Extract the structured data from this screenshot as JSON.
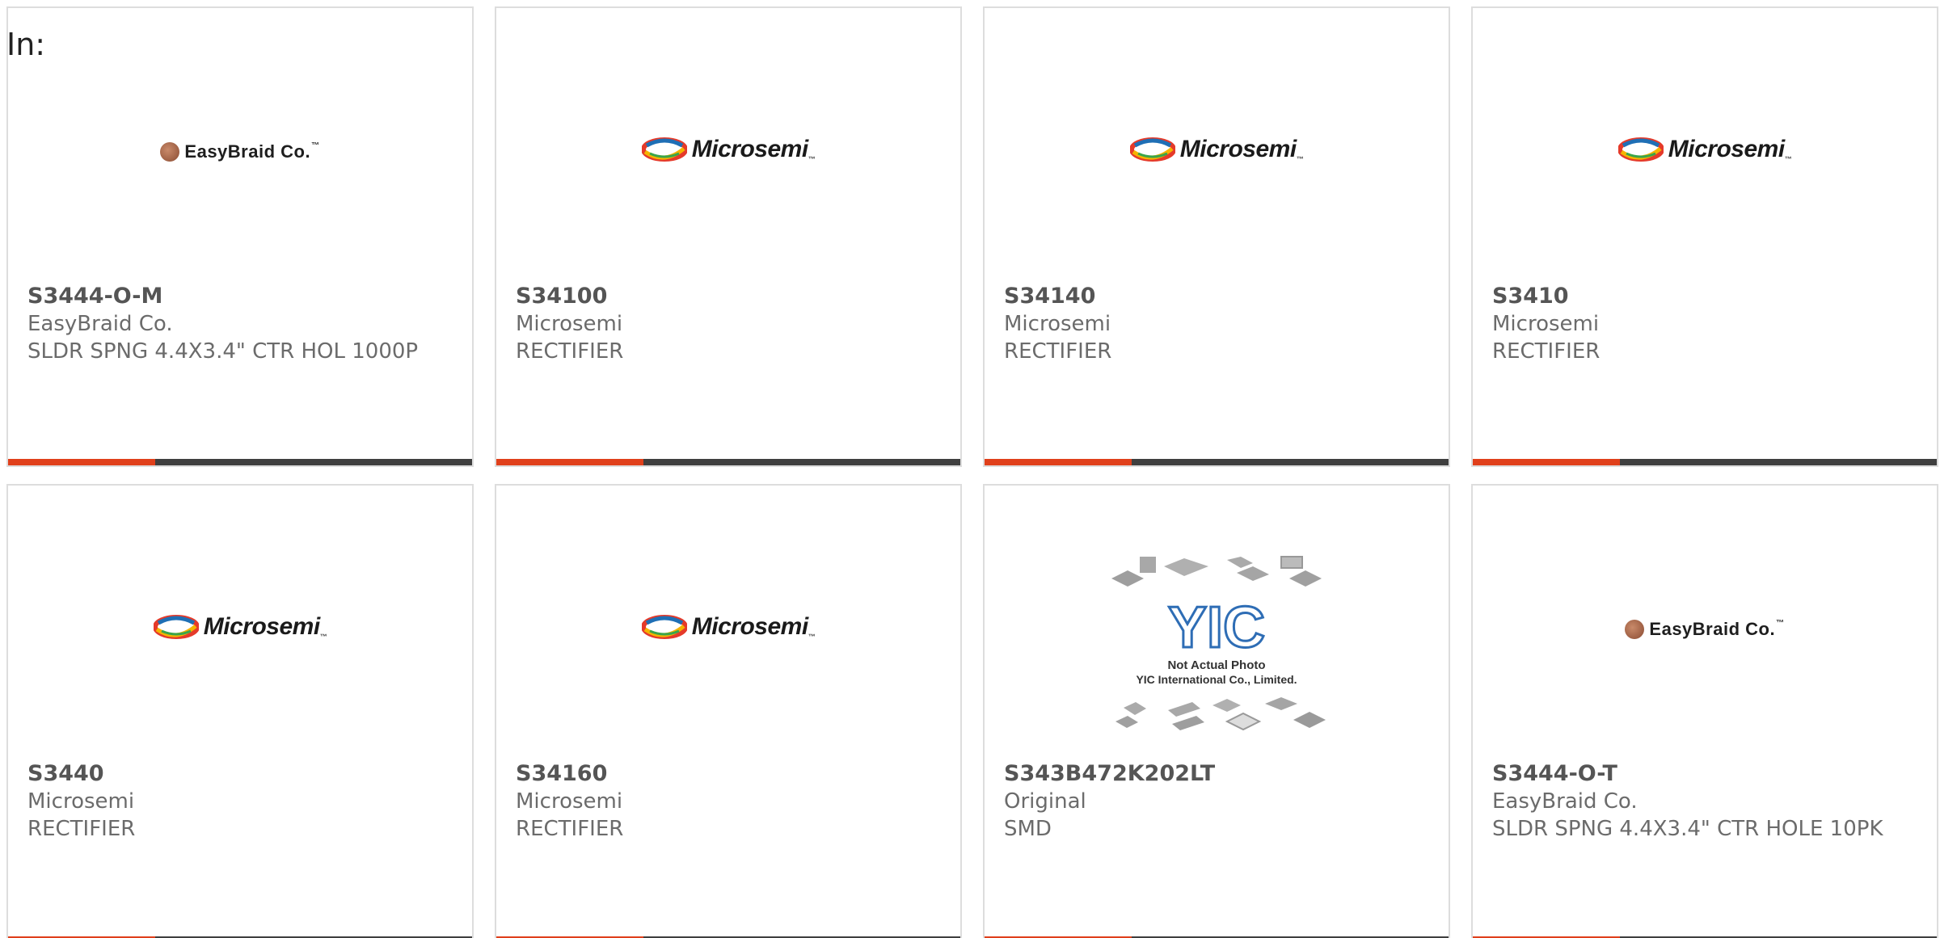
{
  "header": {
    "in_label": "In:"
  },
  "colors": {
    "accent_bar": "#e0401b",
    "dark_bar": "#3f3f3f",
    "card_border": "#dddddd",
    "text_muted": "#6b6b6b"
  },
  "products": [
    {
      "part": "S3444-O-M",
      "manufacturer": "EasyBraid Co.",
      "description": "SLDR SPNG 4.4X3.4\" CTR HOL 1000P",
      "logo": "easybraid-logo",
      "logo_text": "EasyBraid Co."
    },
    {
      "part": "S34100",
      "manufacturer": "Microsemi",
      "description": "RECTIFIER",
      "logo": "microsemi-logo",
      "logo_text": "Microsemi"
    },
    {
      "part": "S34140",
      "manufacturer": "Microsemi",
      "description": "RECTIFIER",
      "logo": "microsemi-logo",
      "logo_text": "Microsemi"
    },
    {
      "part": "S3410",
      "manufacturer": "Microsemi",
      "description": "RECTIFIER",
      "logo": "microsemi-logo",
      "logo_text": "Microsemi"
    },
    {
      "part": "S3440",
      "manufacturer": "Microsemi",
      "description": "RECTIFIER",
      "logo": "microsemi-logo",
      "logo_text": "Microsemi"
    },
    {
      "part": "S34160",
      "manufacturer": "Microsemi",
      "description": "RECTIFIER",
      "logo": "microsemi-logo",
      "logo_text": "Microsemi"
    },
    {
      "part": "S343B472K202LT",
      "manufacturer": "Original",
      "description": "SMD",
      "logo": "yic-placeholder-image",
      "logo_text": "YIC",
      "logo_caption_1": "Not Actual Photo",
      "logo_caption_2": "YIC International Co., Limited."
    },
    {
      "part": "S3444-O-T",
      "manufacturer": "EasyBraid Co.",
      "description": "SLDR SPNG 4.4X3.4\" CTR HOLE 10PK",
      "logo": "easybraid-logo",
      "logo_text": "EasyBraid Co."
    }
  ]
}
